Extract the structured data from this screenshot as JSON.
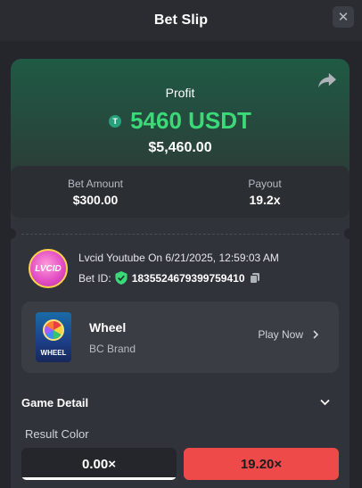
{
  "header": {
    "title": "Bet Slip",
    "close_symbol": "✕"
  },
  "profit": {
    "label": "Profit",
    "currency_icon": "T",
    "amount": "5460 USDT",
    "fiat": "$5,460.00"
  },
  "stats": {
    "bet_amount_label": "Bet Amount",
    "bet_amount_value": "$300.00",
    "payout_label": "Payout",
    "payout_value": "19.2x"
  },
  "bet": {
    "logo_text": "LVCID",
    "user_line": "Lvcid Youtube On 6/21/2025, 12:59:03 AM",
    "id_label": "Bet ID:",
    "id_value": "1835524679399759410"
  },
  "game": {
    "thumb_text": "WHEEL",
    "name": "Wheel",
    "brand": "BC Brand",
    "play_label": "Play Now"
  },
  "detail": {
    "title": "Game Detail",
    "result_label": "Result Color",
    "options": [
      {
        "label": "0.00×",
        "color": "#ffffff"
      },
      {
        "label": "19.20×",
        "color": "#ef4a4a"
      }
    ]
  },
  "colors": {
    "accent_green": "#3bd978",
    "usdt": "#26a17b",
    "red": "#ef4a4a"
  }
}
